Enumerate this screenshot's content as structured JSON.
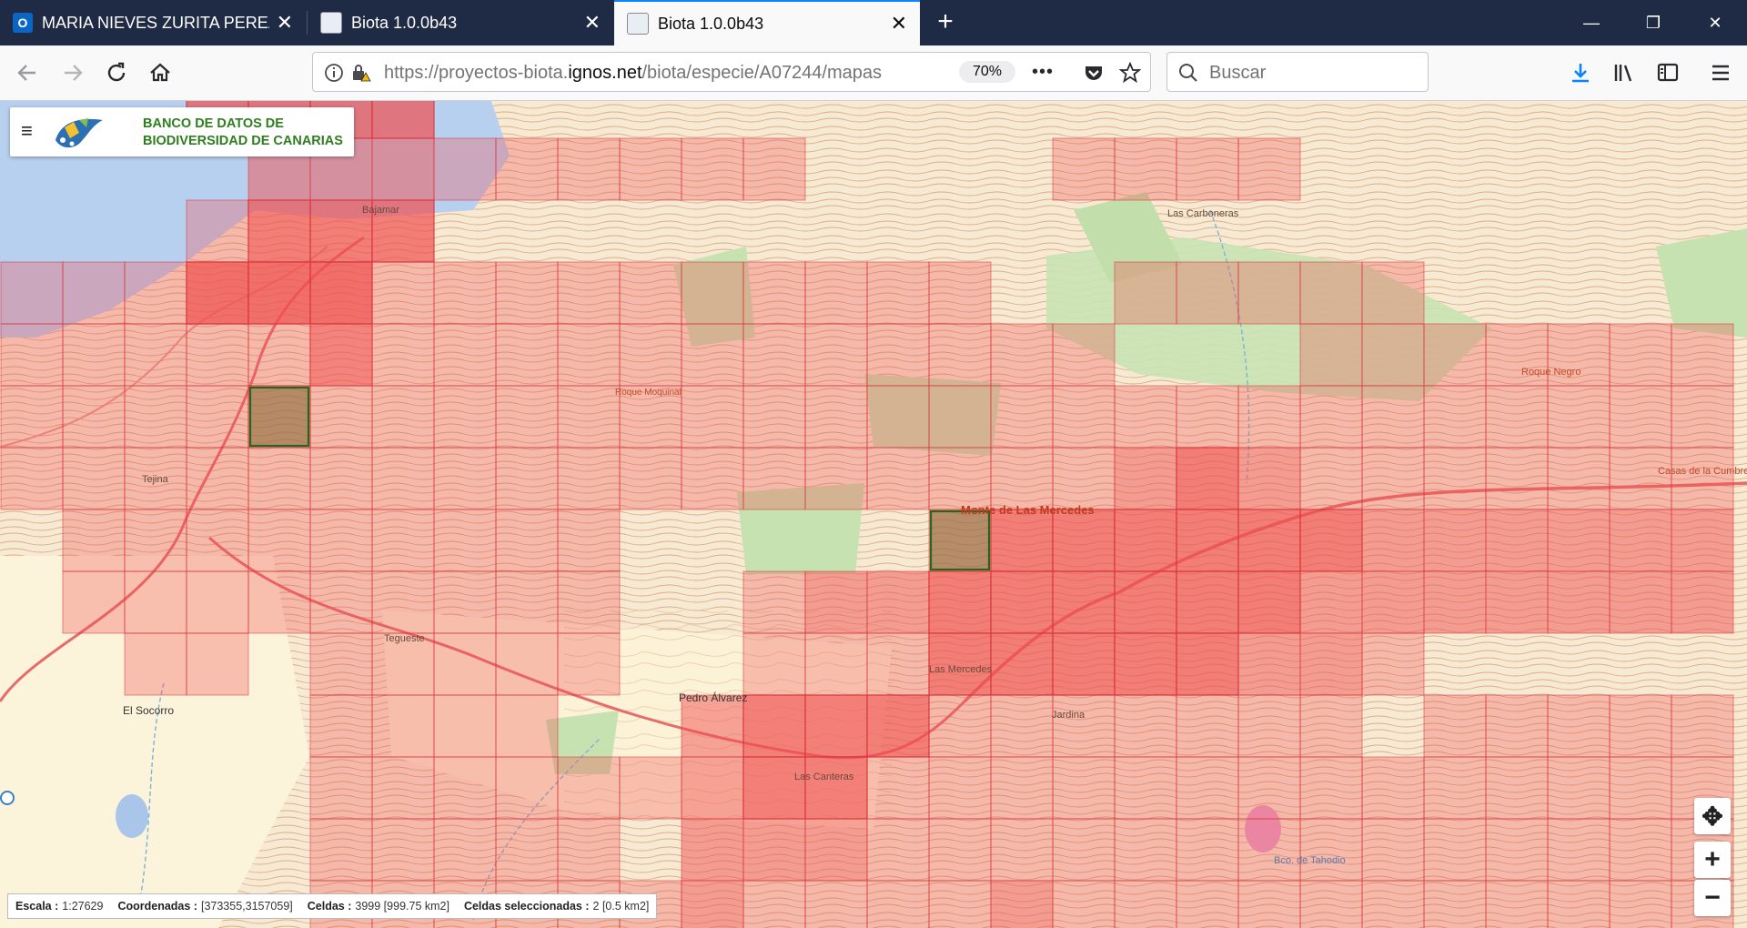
{
  "browser": {
    "tabs": [
      {
        "label": "MARIA NIEVES ZURITA PEREZ -",
        "favicon": "outlook-icon",
        "close": "✕"
      },
      {
        "label": "Biota 1.0.0b43",
        "favicon": "biota-icon",
        "close": "✕"
      },
      {
        "label": "Biota 1.0.0b43",
        "favicon": "biota-icon",
        "close": "✕"
      }
    ],
    "new_tab": "+",
    "window_controls": {
      "minimize": "—",
      "restore": "❐",
      "close": "✕"
    },
    "url_prefix": "https://proyectos-biota.",
    "url_domain": "ignos.net",
    "url_path": "/biota/especie/A07244/mapas",
    "zoom": "70%",
    "more": "•••",
    "search_placeholder": "Buscar",
    "search_value": ""
  },
  "app": {
    "menu_glyph": "≡",
    "title_line1": "BANCO DE DATOS DE",
    "title_line2": "BIODIVERSIDAD DE CANARIAS"
  },
  "map": {
    "places": {
      "bajamar": "Bajamar",
      "las_carboneras": "Las Carboneras",
      "roque_moquinal": "Roque Moquinal",
      "roque_negro": "Roque Negro",
      "tejina": "Tejina",
      "monte": "Monte de Las Mercedes",
      "casas": "Casas de la Cumbre",
      "tegueste": "Tegueste",
      "el_socorro": "El Socorro",
      "pedro_alvarez": "Pedro Álvarez",
      "las_mercedes": "Las Mercedes",
      "jardina": "Jardina",
      "las_canteras": "Las Canteras",
      "bco_tahodio": "Bco. de Tahodio"
    },
    "controls": {
      "pan": "✥",
      "zoom_in": "+",
      "zoom_out": "−"
    }
  },
  "status": {
    "scale_label": "Escala :",
    "scale_value": "1:27629",
    "coords_label": "Coordenadas :",
    "coords_value": "[373355,3157059]",
    "cells_label": "Celdas :",
    "cells_value": "3999 [999.75 km2]",
    "selected_label": "Celdas seleccionadas :",
    "selected_value": "2 [0.5 km2]"
  },
  "colors": {
    "tabbar": "#1f2a44",
    "cell_fill": "#f05050",
    "cell_stroke": "#d9363e",
    "selected_cell_stroke": "#1e6b1e",
    "brand_green": "#2f7d1f",
    "sea": "#b8d0ef",
    "forest": "#c8e4b4",
    "contour": "#d9a070"
  }
}
